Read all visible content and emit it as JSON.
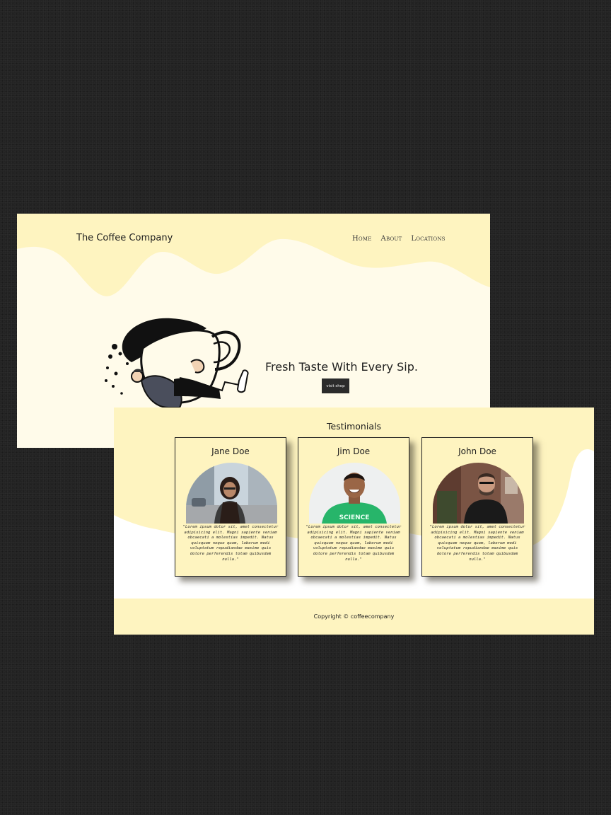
{
  "hero_page": {
    "brand": "The Coffee Company",
    "nav": [
      "Home",
      "About",
      "Locations"
    ],
    "title": "Fresh Taste With Every Sip.",
    "button_label": "visit shop",
    "illustration": "man-hugging-coffee-cup-illustration"
  },
  "testimonials_page": {
    "title": "Testimonials",
    "cards": [
      {
        "name": "Jane Doe",
        "photo": "woman-glasses-street-photo",
        "quote": "\"Lorem ipsum dolor sit, amet consectetur adipisicing elit. Magni sapiente veniam obcaecati a molestias impedit. Natus quisquam neque quam, laborum modi voluptatum repudiandae maxime quis dolore perferendis totam quibusdam nulla.\""
      },
      {
        "name": "Jim Doe",
        "photo": "man-green-science-shirt-photo",
        "photo_text": "SCIENCE",
        "quote": "\"Lorem ipsum dolor sit, amet consectetur adipisicing elit. Magni sapiente veniam obcaecati a molestias impedit. Natus quisquam neque quam, laborum modi voluptatum repudiandae maxime quis dolore perferendis totam quibusdam nulla.\""
      },
      {
        "name": "John Doe",
        "photo": "man-glasses-black-sweater-photo",
        "quote": "\"Lorem ipsum dolor sit, amet consectetur adipisicing elit. Magni sapiente veniam obcaecati a molestias impedit. Natus quisquam neque quam, laborum modi voluptatum repudiandae maxime quis dolore perferendis totam quibusdam nulla.\""
      }
    ],
    "copyright": "Copyright © coffeecompany"
  },
  "colors": {
    "background": "#232323",
    "cream": "#fffbea",
    "yellow": "#fef4c0",
    "button": "#2b2b2b"
  }
}
